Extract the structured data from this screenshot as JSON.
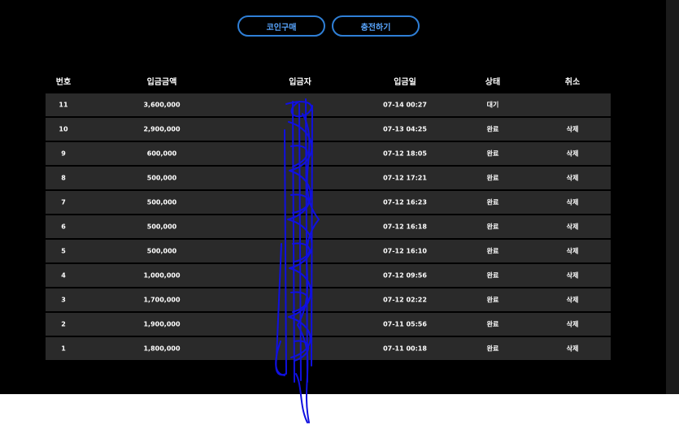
{
  "buttons": {
    "coin_purchase": "코인구매",
    "charge": "충전하기"
  },
  "columns": {
    "no": "번호",
    "amount": "입금금액",
    "depositor": "입금자",
    "date": "입금일",
    "status": "상태",
    "cancel": "취소"
  },
  "rows": [
    {
      "no": "11",
      "amount": "3,600,000",
      "date": "07-14 00:27",
      "status": "대기",
      "cancel": ""
    },
    {
      "no": "10",
      "amount": "2,900,000",
      "date": "07-13 04:25",
      "status": "완료",
      "cancel": "삭제"
    },
    {
      "no": "9",
      "amount": "600,000",
      "date": "07-12 18:05",
      "status": "완료",
      "cancel": "삭제"
    },
    {
      "no": "8",
      "amount": "500,000",
      "date": "07-12 17:21",
      "status": "완료",
      "cancel": "삭제"
    },
    {
      "no": "7",
      "amount": "500,000",
      "date": "07-12 16:23",
      "status": "완료",
      "cancel": "삭제"
    },
    {
      "no": "6",
      "amount": "500,000",
      "date": "07-12 16:18",
      "status": "완료",
      "cancel": "삭제"
    },
    {
      "no": "5",
      "amount": "500,000",
      "date": "07-12 16:10",
      "status": "완료",
      "cancel": "삭제"
    },
    {
      "no": "4",
      "amount": "1,000,000",
      "date": "07-12 09:56",
      "status": "완료",
      "cancel": "삭제"
    },
    {
      "no": "3",
      "amount": "1,700,000",
      "date": "07-12 02:22",
      "status": "완료",
      "cancel": "삭제"
    },
    {
      "no": "2",
      "amount": "1,900,000",
      "date": "07-11 05:56",
      "status": "완료",
      "cancel": "삭제"
    },
    {
      "no": "1",
      "amount": "1,800,000",
      "date": "07-11 00:18",
      "status": "완료",
      "cancel": "삭제"
    }
  ],
  "colors": {
    "background": "#000000",
    "row": "#2a2a2a",
    "button_border": "#2f7fd6",
    "button_text": "#59a6ff",
    "redaction": "#1010e0"
  }
}
